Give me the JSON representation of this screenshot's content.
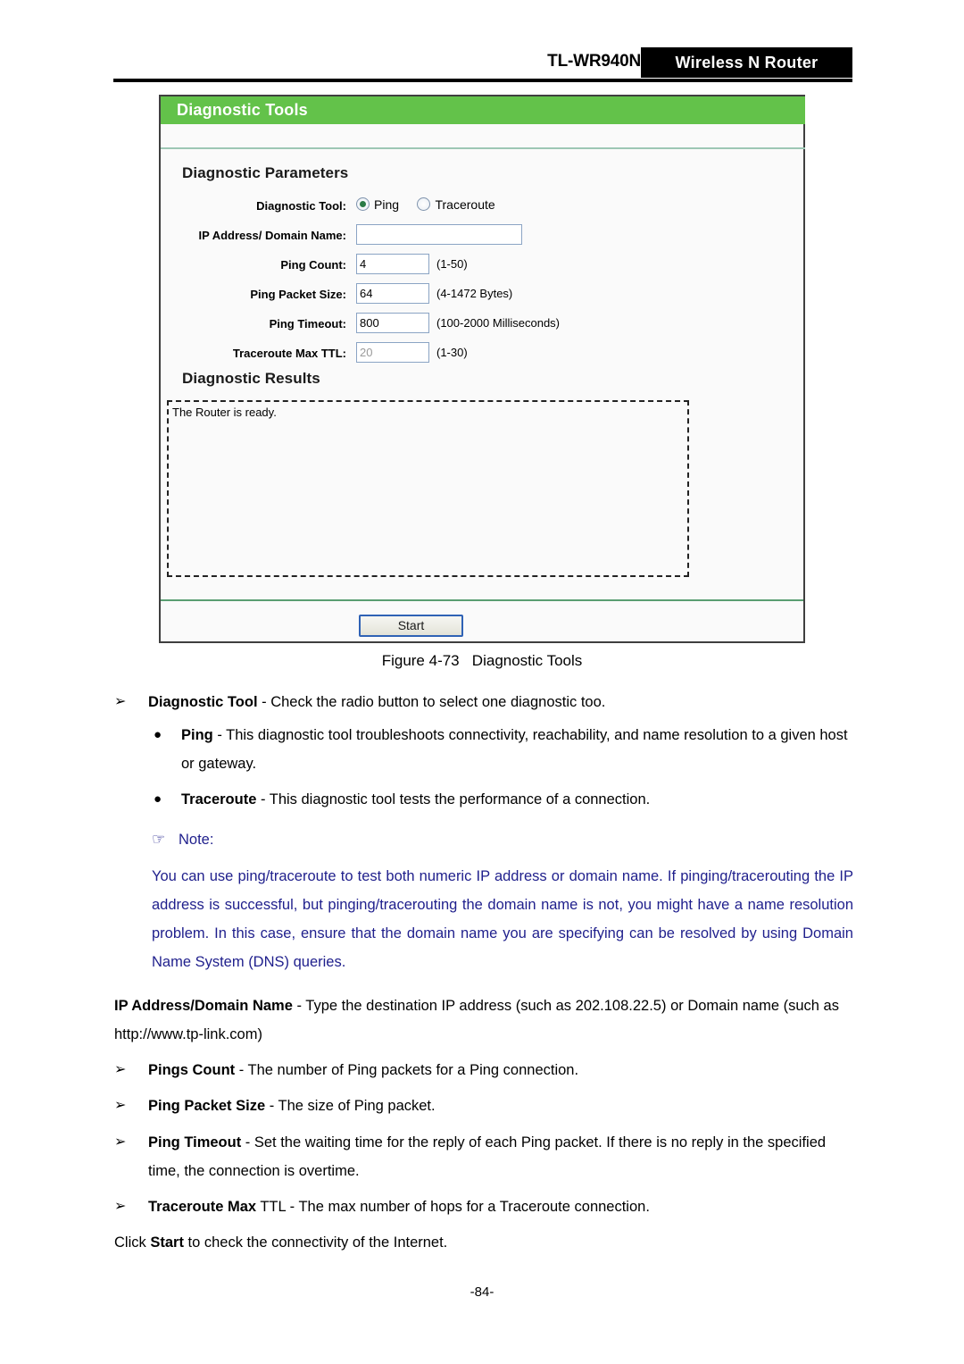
{
  "header": {
    "model": "TL-WR940N",
    "banner_text": "Wireless N Router"
  },
  "router_ui": {
    "panel_title": "Diagnostic Tools",
    "sections": {
      "parameters_heading": "Diagnostic Parameters",
      "results_heading": "Diagnostic Results"
    },
    "fields": {
      "diagnostic_tool": {
        "label": "Diagnostic Tool:",
        "options": [
          {
            "label": "Ping",
            "selected": true
          },
          {
            "label": "Traceroute",
            "selected": false
          }
        ]
      },
      "ip_address": {
        "label": "IP Address/ Domain Name:",
        "value": "",
        "hint": ""
      },
      "ping_count": {
        "label": "Ping Count:",
        "value": "4",
        "hint": "(1-50)"
      },
      "ping_packet_size": {
        "label": "Ping Packet Size:",
        "value": "64",
        "hint": "(4-1472 Bytes)"
      },
      "ping_timeout": {
        "label": "Ping Timeout:",
        "value": "800",
        "hint": "(100-2000 Milliseconds)"
      },
      "traceroute_max_ttl": {
        "label": "Traceroute Max TTL:",
        "value": "20",
        "hint": "(1-30)",
        "disabled": true
      }
    },
    "results_text": "The Router is ready.",
    "start_button": "Start",
    "colors": {
      "title_bar_green": "#63c24a",
      "separator_green": "#5a9e72",
      "button_border_blue": "#2f62b5",
      "radio_dot_green": "#2a7a46",
      "input_border": "#8ba4c4"
    }
  },
  "figure_caption": "Figure 4-73   Diagnostic Tools",
  "content": {
    "bullet_marker_l1": "➢",
    "bullet_marker_l2": "●",
    "note_marker": "☞",
    "note_label": "Note:",
    "note_color": "#1f1f8c",
    "items": {
      "diagnostic_tool_term": "Diagnostic Tool",
      "diagnostic_tool_desc": " - Check the radio button to select one diagnostic too.",
      "ping_term": "Ping",
      "ping_desc": " - This diagnostic tool troubleshoots connectivity, reachability, and name resolution to a given host or gateway.",
      "traceroute_term": "Traceroute",
      "traceroute_desc": " - This diagnostic tool tests the performance of a connection.",
      "note_paragraph": "You can use ping/traceroute to test both numeric IP address or domain name. If pinging/tracerouting the IP address is successful, but pinging/tracerouting the domain name is not, you might have a name resolution problem. In this case, ensure that the domain name you are specifying can be resolved by using Domain Name System (DNS) queries.",
      "ip_term": "IP Address/Domain Name",
      "ip_desc": " - Type the destination IP address (such as 202.108.22.5) or Domain name (such as http://www.tp-link.com)",
      "pings_count_term": "Pings Count",
      "pings_count_desc": " - The number of Ping packets for a Ping connection.",
      "packet_size_term": "Ping Packet Size",
      "packet_size_desc": " - The size of Ping packet.",
      "timeout_term": "Ping Timeout",
      "timeout_desc": " - Set the waiting time for the reply of each Ping packet. If there is no reply in the specified time, the connection is overtime.",
      "max_ttl_term": "Traceroute Max",
      "max_ttl_term_plain": " TTL",
      "max_ttl_desc": " - The max number of hops for a Traceroute connection.",
      "click_start_pre": "Click ",
      "click_start_bold": "Start",
      "click_start_post": " to check the connectivity of the Internet."
    }
  },
  "page_number": "-84-"
}
